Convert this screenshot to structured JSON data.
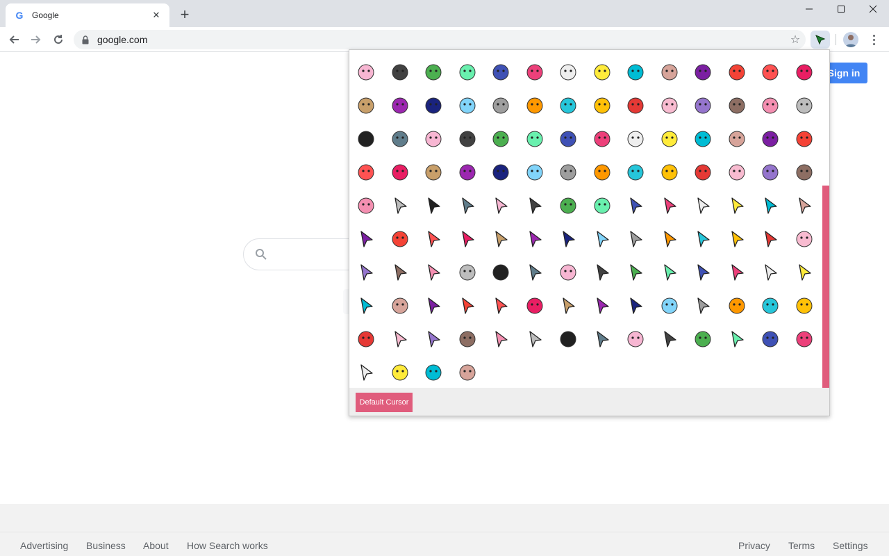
{
  "browser": {
    "tab_title": "Google",
    "new_tab_symbol": "+",
    "url": "google.com",
    "window_controls": [
      "minimize",
      "maximize",
      "close"
    ]
  },
  "page": {
    "signin_label": "Sign in",
    "footer_left": [
      "Advertising",
      "Business",
      "About",
      "How Search works"
    ],
    "footer_right": [
      "Privacy",
      "Terms",
      "Settings"
    ]
  },
  "popup": {
    "default_button_label": "Default Cursor",
    "accent_color": "#e05c7c",
    "cursor_icons": [
      "easter-egg",
      "candy",
      "pig",
      "macaron",
      "skull-donut",
      "pink-unicorn",
      "white-unicorn",
      "panda",
      "puppy",
      "hamster",
      "purple-egg",
      "pink-egg",
      "bunny",
      "rainbow-face",
      "rainbow-popsicle",
      "rainbow-poop",
      "rainbow-skull",
      "nyan-rainbow",
      "red-ghost",
      "devil-cat",
      "bat",
      "panda-face",
      "skeleton",
      "teddy-bear",
      "skull-crossbones",
      "ghost-small",
      "yellow-face",
      "smiley",
      "grin-face",
      "white-ghost",
      "ghost-tongue",
      "ghost-outline",
      "white-dog",
      "girl-face",
      "soot-sprite",
      "black-soot",
      "hand-pointer",
      "heart-sweet",
      "cat",
      "totoro",
      "unicorn-pink",
      "unicorn-rainbow",
      "unicorn-head",
      "pink-feather",
      "white-bird",
      "white-bunny",
      "pink-bunny",
      "raccoon",
      "white-llama",
      "cow",
      "penguin",
      "green-bunny",
      "green-cat",
      "bear-face",
      "candy-cane",
      "birthday-cake",
      "yellow-blob",
      "navy-arrow",
      "cyan-arrow",
      "mint-arrow",
      "gray-arrow",
      "rocket-arrow",
      "paper-plane",
      "rocket",
      "red-arrow",
      "stick",
      "beige-arrow",
      "dagger",
      "crosshair",
      "outline-arrow",
      "black-arrow",
      "glove-hand",
      "pink-arrow",
      "white-arrow",
      "gradient-arrow",
      "coral-arrow",
      "dark-arrow",
      "gray-arrow-2",
      "white-arrow-2",
      "checker-arrow",
      "blue-arrow",
      "star-arrow",
      "lavender-arrow",
      "green-leaf",
      "blue-outline-arrow",
      "light-blue-arrow",
      "purple-arrow",
      "red-dot",
      "telescope",
      "black-pink-arrow",
      "dinosaur",
      "pixel-arrow",
      "green-glitter-arrow",
      "olive-arrow",
      "rainbow-arrow",
      "sage-arrow",
      "pink-outline-arrow",
      "galaxy-arrow",
      "sparkle-arrow",
      "purple-dot",
      "dark-arrow-2",
      "sword",
      "color-arrow",
      "feather",
      "blue-arrow-2",
      "gold-arrow",
      "green-arrow",
      "hazard",
      "ice-arrow",
      "biohazard",
      "fire",
      "wave",
      "traffic-cone",
      "red-3d-arrow",
      "dark-arrow-3",
      "golden-shield",
      "rose-arrow",
      "violet-arrow",
      "blue-gem",
      "white-3d-arrow",
      "cloud",
      "aqua-arrow",
      "blue-crystal",
      "black-arrow-2",
      "lightning",
      "pink-crystal",
      "blue-purple-arrow",
      "rainbow-pinwheel",
      "party-hat",
      "cloud-hand"
    ]
  }
}
